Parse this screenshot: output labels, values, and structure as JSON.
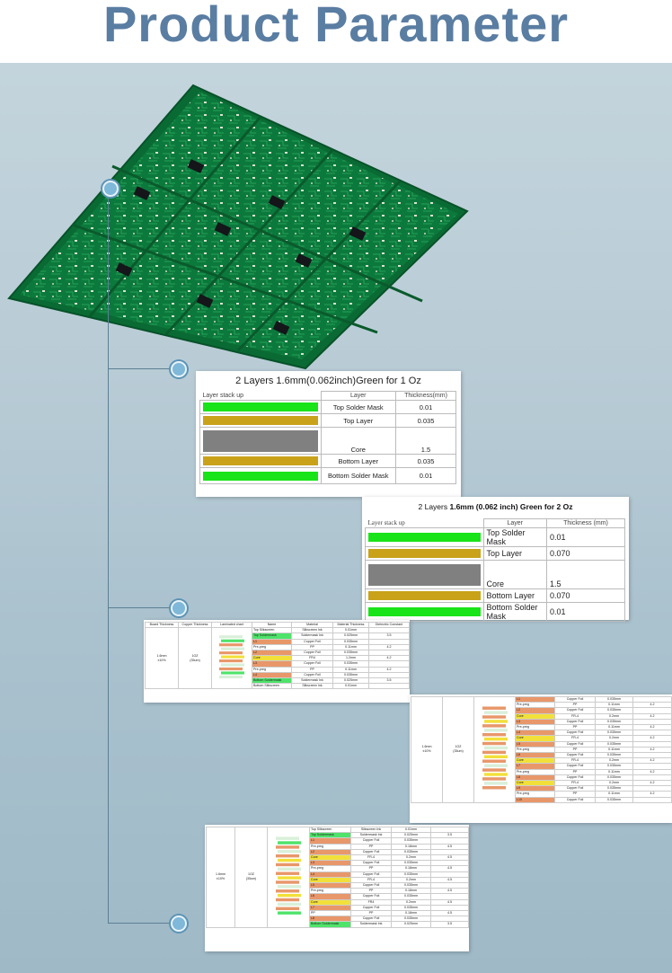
{
  "page": {
    "title": "Product Parameter"
  },
  "stack1": {
    "title": "2 Layers 1.6mm(0.062inch)Green for 1 Oz",
    "h_stack": "Layer stack up",
    "h_layer": "Layer",
    "h_thick": "Thickness(mm)",
    "rows": [
      {
        "layer": "Top Solder Mask",
        "thick": "0.01",
        "color": "#19e319"
      },
      {
        "layer": "Top Layer",
        "thick": "0.035",
        "color": "#c9a21a"
      },
      {
        "layer": "Core",
        "thick": "1.5",
        "color": "#808080"
      },
      {
        "layer": "Bottom Layer",
        "thick": "0.035",
        "color": "#c9a21a"
      },
      {
        "layer": "Bottom Solder Mask",
        "thick": "0.01",
        "color": "#19e319"
      }
    ]
  },
  "stack2": {
    "title_pre": "2 Layers ",
    "title_bold": "1.6mm (0.062 inch) Green for 2 Oz",
    "h_stack": "Layer stack up",
    "h_layer": "Layer",
    "h_thick": "Thickness (mm)",
    "rows": [
      {
        "layer": "Top Solder Mask",
        "thick": "0.01"
      },
      {
        "layer": "Top Layer",
        "thick": "0.070"
      },
      {
        "layer": "Core",
        "thick": "1.5"
      },
      {
        "layer": "Bottom Layer",
        "thick": "0.070"
      },
      {
        "layer": "Bottom  Solder Mask",
        "thick": "0.01"
      }
    ]
  },
  "table4": {
    "headers": [
      "Board Thickness",
      "Copper Thickness",
      "Laminated chart",
      "Name",
      "Material",
      "Material Thickness",
      "Dielectric Constant"
    ],
    "board": "1.6mm\n±10%",
    "copper": "1OZ\n(35um)",
    "rows": [
      {
        "name": "Top Silkscreen",
        "mat": "Silkscreen Ink",
        "th": "0.01mm",
        "dc": ""
      },
      {
        "name": "Top Soldermask",
        "mat": "Soldermask Ink",
        "th": "0.025mm",
        "dc": "3.5"
      },
      {
        "name": "L1",
        "mat": "Copper Foil",
        "th": "0.035mm",
        "dc": ""
      },
      {
        "name": "Pre-preg",
        "mat": "PP",
        "th": "0.11mm",
        "dc": "4.2"
      },
      {
        "name": "L2",
        "mat": "Copper Foil",
        "th": "0.035mm",
        "dc": ""
      },
      {
        "name": "Core",
        "mat": "FR4",
        "th": "1.2mm",
        "dc": "4.2"
      },
      {
        "name": "L3",
        "mat": "Copper Foil",
        "th": "0.035mm",
        "dc": ""
      },
      {
        "name": "Pre-preg",
        "mat": "PP",
        "th": "0.11mm",
        "dc": "4.2"
      },
      {
        "name": "L4",
        "mat": "Copper Foil",
        "th": "0.035mm",
        "dc": ""
      },
      {
        "name": "Bottom Soldermask",
        "mat": "Soldermask Ink",
        "th": "0.025mm",
        "dc": "3.5"
      },
      {
        "name": "Bottom Silkscreen",
        "mat": "Silkscreen Ink",
        "th": "0.01mm",
        "dc": ""
      }
    ]
  },
  "table10": {
    "board": "1.6mm\n±10%",
    "copper": "1OZ\n(35um)",
    "rows": [
      {
        "name": "L1",
        "mat": "Copper Foil",
        "th": "0.035mm",
        "dc": ""
      },
      {
        "name": "Pre-preg",
        "mat": "PP",
        "th": "0.11mm",
        "dc": "4.2"
      },
      {
        "name": "L2",
        "mat": "Copper Foil",
        "th": "0.035mm",
        "dc": ""
      },
      {
        "name": "Core",
        "mat": "FR-4",
        "th": "0.2mm",
        "dc": "4.2"
      },
      {
        "name": "L3",
        "mat": "Copper Foil",
        "th": "0.035mm",
        "dc": ""
      },
      {
        "name": "Pre-preg",
        "mat": "PP",
        "th": "0.11mm",
        "dc": "4.2"
      },
      {
        "name": "L4",
        "mat": "Copper Foil",
        "th": "0.035mm",
        "dc": ""
      },
      {
        "name": "Core",
        "mat": "FR-4",
        "th": "0.2mm",
        "dc": "4.2"
      },
      {
        "name": "L5",
        "mat": "Copper Foil",
        "th": "0.035mm",
        "dc": ""
      },
      {
        "name": "Pre-preg",
        "mat": "PP",
        "th": "0.11mm",
        "dc": "4.2"
      },
      {
        "name": "L6",
        "mat": "Copper Foil",
        "th": "0.035mm",
        "dc": ""
      },
      {
        "name": "Core",
        "mat": "FR-4",
        "th": "0.2mm",
        "dc": "4.2"
      },
      {
        "name": "L7",
        "mat": "Copper Foil",
        "th": "0.035mm",
        "dc": ""
      },
      {
        "name": "Pre-preg",
        "mat": "PP",
        "th": "0.11mm",
        "dc": "4.2"
      },
      {
        "name": "L8",
        "mat": "Copper Foil",
        "th": "0.035mm",
        "dc": ""
      },
      {
        "name": "Core",
        "mat": "FR-4",
        "th": "0.2mm",
        "dc": "4.2"
      },
      {
        "name": "L9",
        "mat": "Copper Foil",
        "th": "0.035mm",
        "dc": ""
      },
      {
        "name": "Pre-preg",
        "mat": "PP",
        "th": "0.11mm",
        "dc": "4.2"
      },
      {
        "name": "L10",
        "mat": "Copper Foil",
        "th": "0.035mm",
        "dc": ""
      }
    ]
  },
  "table8": {
    "board": "1.6mm\n±10%",
    "copper": "1OZ\n(35um)",
    "rows": [
      {
        "name": "Top Silkscreen",
        "mat": "Silkscreen Ink",
        "th": "0.01mm",
        "dc": ""
      },
      {
        "name": "Top Soldermask",
        "mat": "Soldermask Ink",
        "th": "0.025mm",
        "dc": "3.5"
      },
      {
        "name": "L1",
        "mat": "Copper Foil",
        "th": "0.035mm",
        "dc": ""
      },
      {
        "name": "Pre-preg",
        "mat": "PP",
        "th": "0.18mm",
        "dc": "4.5"
      },
      {
        "name": "L2",
        "mat": "Copper Foil",
        "th": "0.035mm",
        "dc": ""
      },
      {
        "name": "Core",
        "mat": "FR-4",
        "th": "0.2mm",
        "dc": "4.5"
      },
      {
        "name": "L3",
        "mat": "Copper Foil",
        "th": "0.035mm",
        "dc": ""
      },
      {
        "name": "Pre-preg",
        "mat": "PP",
        "th": "0.18mm",
        "dc": "4.5"
      },
      {
        "name": "L4",
        "mat": "Copper Foil",
        "th": "0.035mm",
        "dc": ""
      },
      {
        "name": "Core",
        "mat": "FR-4",
        "th": "0.2mm",
        "dc": "4.5"
      },
      {
        "name": "L5",
        "mat": "Copper Foil",
        "th": "0.035mm",
        "dc": ""
      },
      {
        "name": "Pre-preg",
        "mat": "PP",
        "th": "0.18mm",
        "dc": "4.5"
      },
      {
        "name": "L6",
        "mat": "Copper Foil",
        "th": "0.035mm",
        "dc": ""
      },
      {
        "name": "Core",
        "mat": "FR4",
        "th": "0.2mm",
        "dc": "4.5"
      },
      {
        "name": "L7",
        "mat": "Copper Foil",
        "th": "0.035mm",
        "dc": ""
      },
      {
        "name": "PP",
        "mat": "PP",
        "th": "0.18mm",
        "dc": "4.5"
      },
      {
        "name": "L8",
        "mat": "Copper Foil",
        "th": "0.035mm",
        "dc": ""
      },
      {
        "name": "Bottom Soldermask",
        "mat": "Soldermask Ink",
        "th": "0.025mm",
        "dc": "3.5"
      }
    ]
  },
  "colors": {
    "copper": "#e8976a",
    "core": "#f2e03a",
    "pp": "#ffffff",
    "mask": "#4ee36a",
    "silk": "#ffffff",
    "accent": "#5a7da2"
  }
}
